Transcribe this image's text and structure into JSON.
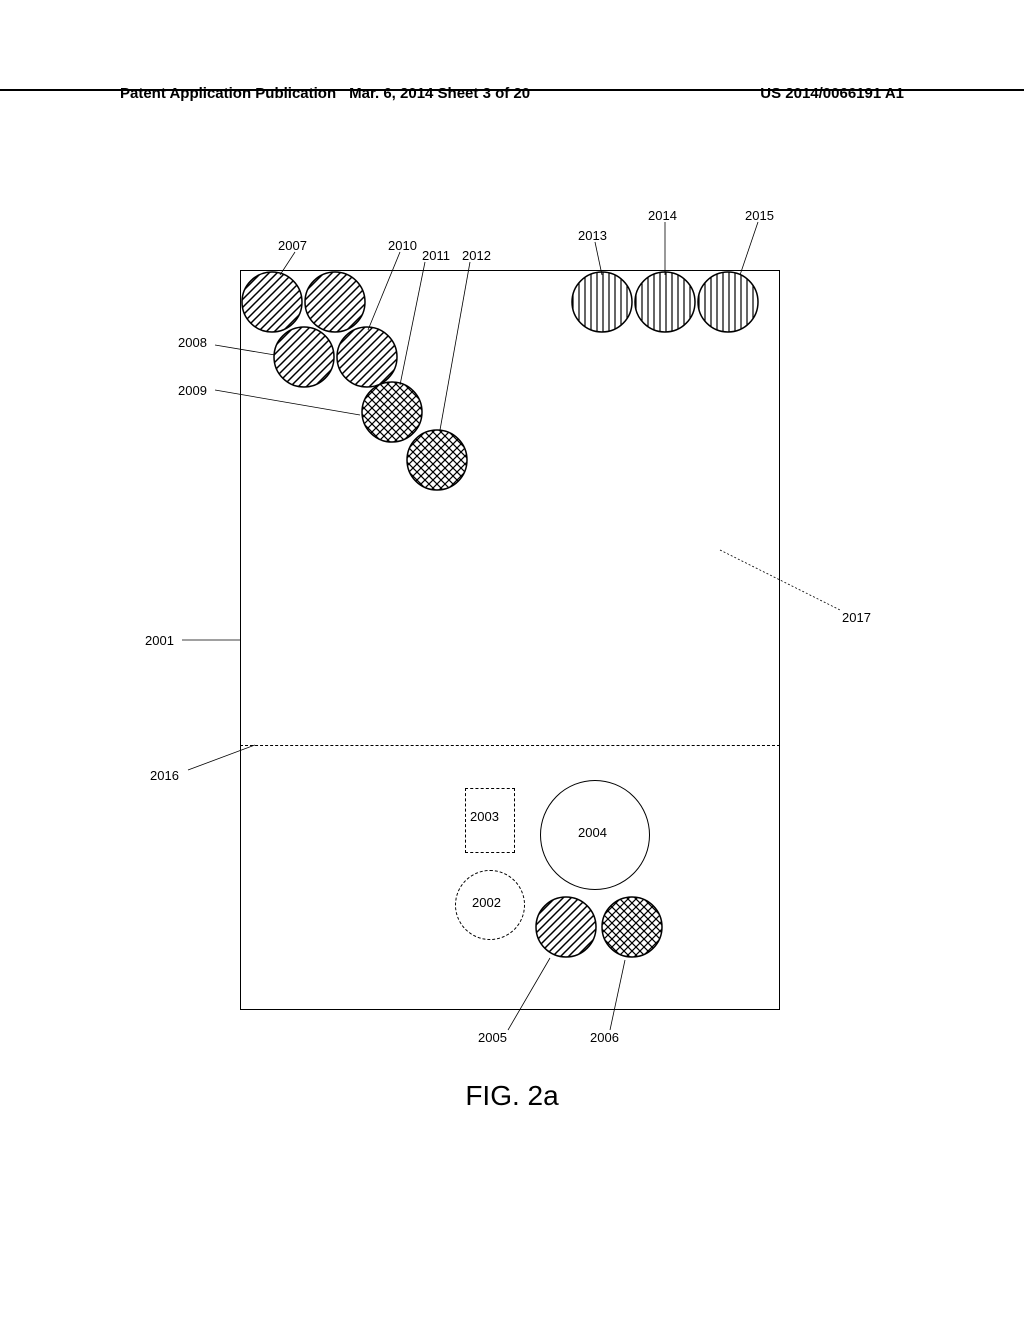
{
  "header": {
    "left": "Patent Application Publication",
    "center": "Mar. 6, 2014  Sheet 3 of 20",
    "right": "US 2014/0066191 A1"
  },
  "figure_label": "FIG. 2a",
  "labels": {
    "l2001": "2001",
    "l2002": "2002",
    "l2003": "2003",
    "l2004": "2004",
    "l2005": "2005",
    "l2006": "2006",
    "l2007": "2007",
    "l2008": "2008",
    "l2009": "2009",
    "l2010": "2010",
    "l2011": "2011",
    "l2012": "2012",
    "l2013": "2013",
    "l2014": "2014",
    "l2015": "2015",
    "l2016": "2016",
    "l2017": "2017"
  }
}
